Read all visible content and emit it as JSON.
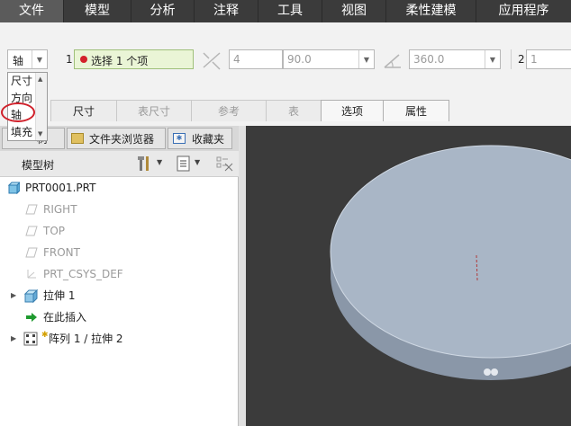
{
  "menu": [
    "文件",
    "模型",
    "分析",
    "注释",
    "工具",
    "视图",
    "柔性建模",
    "应用程序"
  ],
  "ribbon": {
    "type_select": "轴",
    "ref1_num": "1",
    "ref1_text": "选择 1 个项",
    "val_4": "4",
    "val_90": "90.0",
    "val_360": "360.0",
    "ref2_num": "2",
    "ref2_val": "1"
  },
  "dropdown_options": [
    "尺寸",
    "方向",
    "轴",
    "填充"
  ],
  "tabs": [
    {
      "label": "尺寸",
      "state": "normal"
    },
    {
      "label": "表尺寸",
      "state": "disabled"
    },
    {
      "label": "参考",
      "state": "disabled"
    },
    {
      "label": "表",
      "state": "disabled"
    },
    {
      "label": "选项",
      "state": "highlight"
    },
    {
      "label": "属性",
      "state": "highlight"
    }
  ],
  "panel_tabs": [
    "树",
    "文件夹浏览器",
    "收藏夹"
  ],
  "panel_header": "模型树",
  "tree": [
    {
      "label": "PRT0001.PRT",
      "dim": false
    },
    {
      "label": "RIGHT",
      "dim": true
    },
    {
      "label": "TOP",
      "dim": true
    },
    {
      "label": "FRONT",
      "dim": true
    },
    {
      "label": "PRT_CSYS_DEF",
      "dim": true
    },
    {
      "label": "拉伸 1",
      "dim": false
    },
    {
      "label": "在此插入",
      "dim": false
    },
    {
      "label": "阵列 1 / 拉伸 2",
      "dim": false
    }
  ],
  "colors": {
    "menubar": "#3b3b3b",
    "viewport_bg": "#3b3b3b",
    "disk_top": "#a9b6c6",
    "disk_side": "#8997a8",
    "highlight_circle": "#d0202a"
  }
}
